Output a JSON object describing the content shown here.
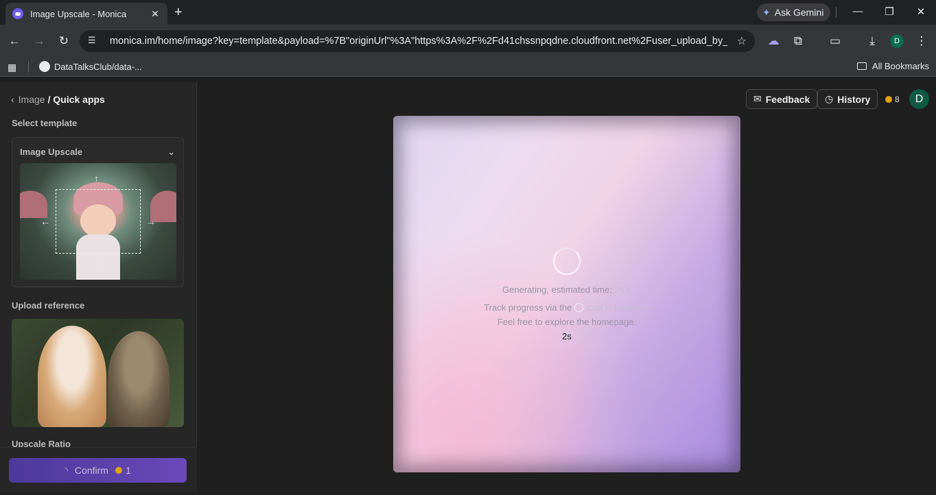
{
  "browser": {
    "tab_title": "Image Upscale - Monica",
    "gemini_label": "Ask Gemini",
    "url": "monica.im/home/image?key=template&payload=%7B\"originUrl\"%3A\"https%3A%2F%2Fd41chssnpqdne.cloudfront.net%2Fuser_upload_by_mo...",
    "profile_initial": "D",
    "bookmark_1": "DataTalksClub/data-...",
    "all_bookmarks": "All Bookmarks"
  },
  "sidebar": {
    "breadcrumb_parent": "Image",
    "breadcrumb_current": "/ Quick apps",
    "select_template_label": "Select template",
    "template_name": "Image Upscale",
    "upload_reference_label": "Upload reference",
    "upscale_ratio_label": "Upscale Ratio",
    "confirm_label": "Confirm",
    "confirm_cost": "1"
  },
  "header": {
    "feedback_label": "Feedback",
    "history_label": "History",
    "credits": "8",
    "avatar_initial": "D"
  },
  "preview": {
    "status_prefix": "Generating, estimated time:",
    "status_time": "25 s",
    "track_prefix": "Track progress via the",
    "track_suffix": "icon in top-right.",
    "explore_text": "Feel free to explore the homepage.",
    "elapsed": "2s"
  },
  "colors": {
    "accent": "#6a49b8",
    "avatar": "#0f5a43",
    "coin": "#e2a400"
  }
}
